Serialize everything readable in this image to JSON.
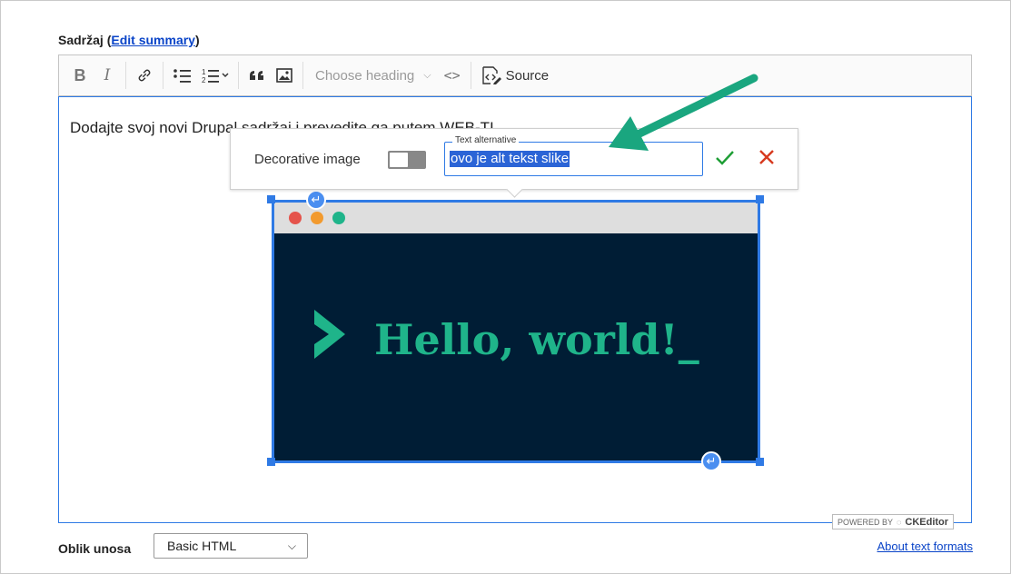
{
  "field": {
    "label": "Sadržaj",
    "paren_open": "(",
    "edit_summary_link": "Edit summary",
    "paren_close": ")"
  },
  "toolbar": {
    "bold": "B",
    "italic": "I",
    "heading_placeholder": "Choose heading",
    "code_label": "<>",
    "source_label": "Source",
    "icons": [
      "bold-icon",
      "italic-icon",
      "link-icon",
      "bulleted-list-icon",
      "numbered-list-icon",
      "blockquote-icon",
      "image-icon",
      "code-icon",
      "source-icon"
    ]
  },
  "editor": {
    "paragraph": "Dodajte svoj novi Drupal sadržaj i prevedite ga putem WEB-TI"
  },
  "image": {
    "window_dots": [
      "#e5534b",
      "#f29a2e",
      "#1fb48a"
    ],
    "hello_text": "Hello, world!_",
    "background": "#001d35",
    "accent": "#1fb48a"
  },
  "balloon": {
    "decorative_label": "Decorative image",
    "decorative_on": false,
    "alt_legend": "Text alternative",
    "alt_value": "ovo je alt tekst slike"
  },
  "powered_by": {
    "prefix": "POWERED BY",
    "brand": "CKEditor"
  },
  "format": {
    "label": "Oblik unosa",
    "selected": "Basic HTML",
    "about_link": "About text formats"
  },
  "colors": {
    "focus_blue": "#2f7ae5",
    "link_blue": "#0a44c8",
    "annotation_green": "#1aa67f",
    "confirm_green": "#1e9e35",
    "cancel_red": "#d73a1f"
  }
}
